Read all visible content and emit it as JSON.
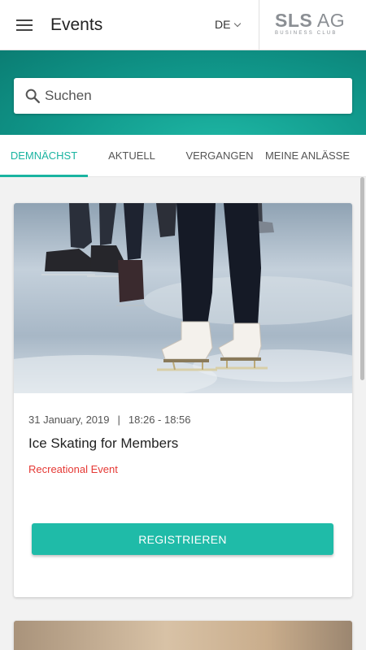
{
  "header": {
    "title": "Events",
    "language": "DE",
    "logo": {
      "main_bold": "SLS",
      "main_rest": " AG",
      "subtitle": "BUSINESS CLUB"
    }
  },
  "search": {
    "placeholder": "Suchen"
  },
  "tabs": [
    {
      "label": "DEMNÄCHST",
      "active": true
    },
    {
      "label": "AKTUELL",
      "active": false
    },
    {
      "label": "VERGANGEN",
      "active": false
    },
    {
      "label": "MEINE ANLÄSSE",
      "active": false
    }
  ],
  "events": [
    {
      "date": "31 January, 2019",
      "separator": "|",
      "time": "18:26 - 18:56",
      "title": "Ice Skating for Members",
      "category": "Recreational Event",
      "button_label": "REGISTRIEREN",
      "image_icon": "ice-skating-photo"
    }
  ],
  "colors": {
    "accent": "#1ab4a1",
    "header_band": "#10978a",
    "category": "#e53935",
    "button": "#1fbba8"
  }
}
